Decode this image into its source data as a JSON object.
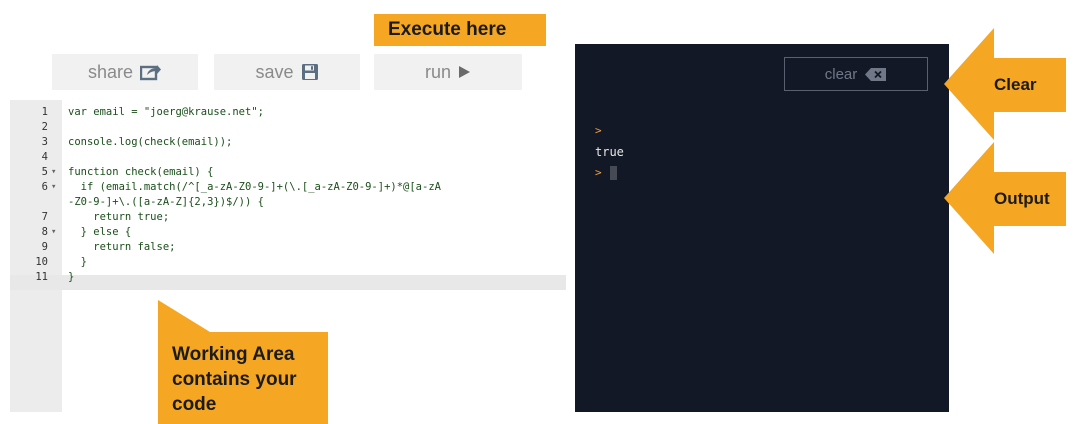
{
  "callouts": {
    "execute": "Execute here",
    "working_lines": [
      "Working Area",
      "contains your",
      "code"
    ],
    "clear": "Clear",
    "output": "Output"
  },
  "toolbar": {
    "share_label": "share",
    "save_label": "save",
    "run_label": "run"
  },
  "console": {
    "clear_label": "clear",
    "prompt_symbol": ">",
    "output_lines": [
      "true"
    ]
  },
  "editor": {
    "active_line": 10,
    "lines": [
      {
        "num": "1",
        "fold": "",
        "text": "var email = \"joerg@krause.net\";"
      },
      {
        "num": "2",
        "fold": "",
        "text": ""
      },
      {
        "num": "3",
        "fold": "",
        "text": "console.log(check(email));"
      },
      {
        "num": "4",
        "fold": "",
        "text": ""
      },
      {
        "num": "5",
        "fold": "▾",
        "text": "function check(email) {"
      },
      {
        "num": "6",
        "fold": "▾",
        "text": "  if (email.match(/^[_a-zA-Z0-9-]+(\\.[_a-zA-Z0-9-]+)*@[a-zA"
      },
      {
        "num": "",
        "fold": "",
        "text": "-Z0-9-]+\\.([a-zA-Z]{2,3})$/)) {"
      },
      {
        "num": "7",
        "fold": "",
        "text": "    return true;"
      },
      {
        "num": "8",
        "fold": "▾",
        "text": "  } else {"
      },
      {
        "num": "9",
        "fold": "",
        "text": "    return false;"
      },
      {
        "num": "10",
        "fold": "",
        "text": "  }"
      },
      {
        "num": "11",
        "fold": "",
        "text": "}"
      }
    ]
  },
  "colors": {
    "callout": "#f5a623",
    "console_bg": "#121826",
    "prompt": "#f2a03d"
  },
  "icons": {
    "share": "share-icon",
    "save": "floppy-disk-icon",
    "run": "play-icon",
    "clear": "backspace-icon"
  }
}
